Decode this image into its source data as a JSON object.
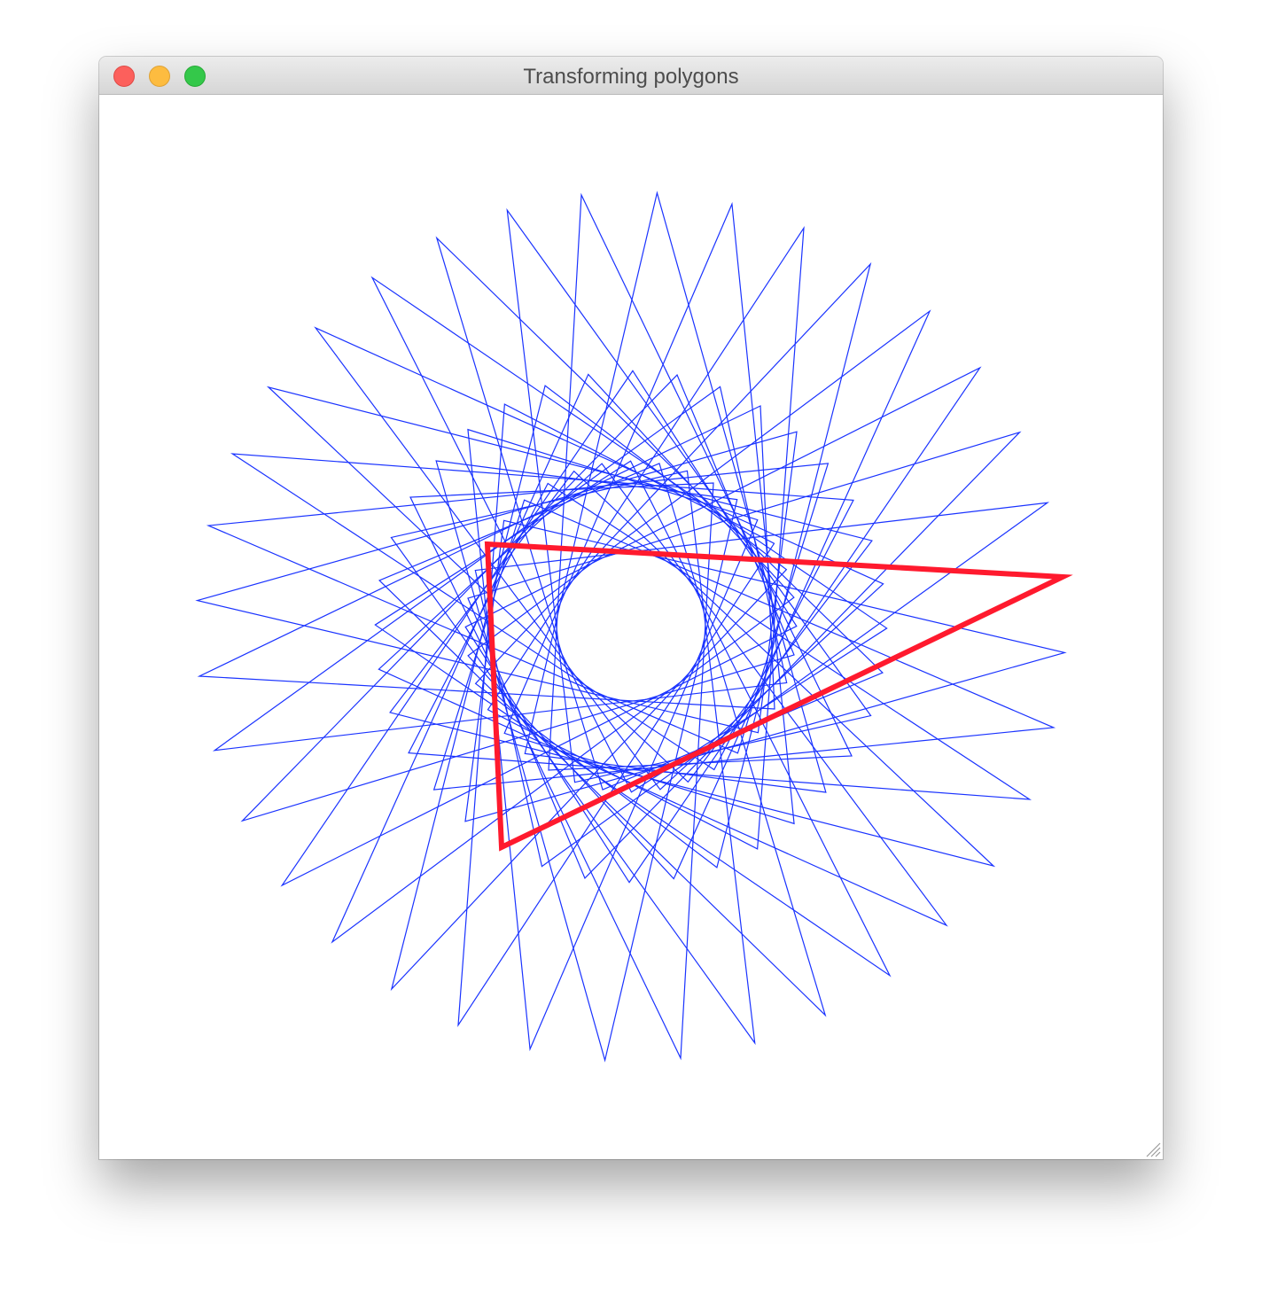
{
  "window": {
    "title": "Transforming polygons"
  },
  "drawing": {
    "type": "rotating-triangle-pattern",
    "spiral_color": "#1a33ff",
    "highlight_color": "#ff1a2e",
    "background_color": "#ffffff",
    "copies": 36,
    "rotation_step_degrees": 10,
    "base_triangle": [
      [
        -162,
        -93
      ],
      [
        487,
        -56
      ],
      [
        -146,
        249
      ]
    ]
  },
  "icons": {
    "close": "close-icon",
    "minimize": "minimize-icon",
    "zoom": "zoom-icon",
    "resize": "resize-grip-icon"
  }
}
